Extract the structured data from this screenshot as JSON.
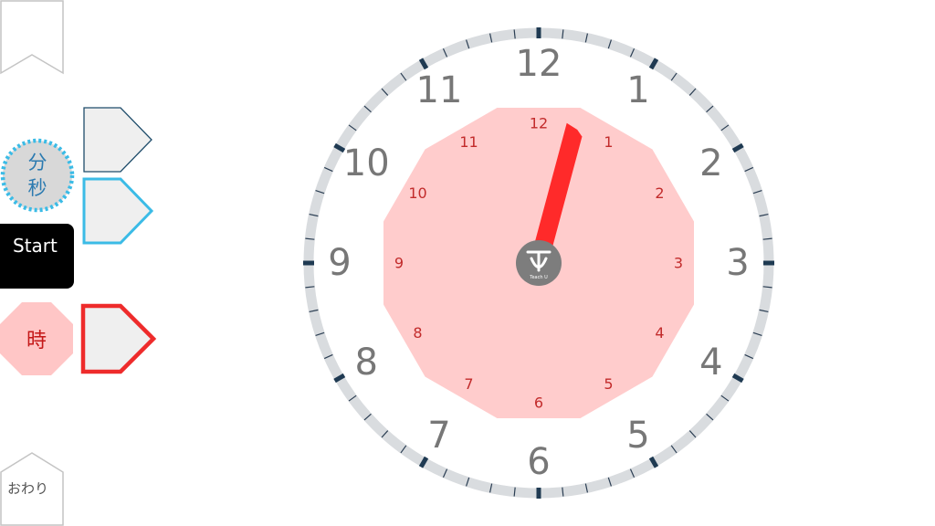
{
  "toolbar": {
    "minsec_label": "分秒",
    "start_label": "Start",
    "hour_label": "時",
    "end_label": "おわり"
  },
  "clock": {
    "outer_numbers": [
      "12",
      "1",
      "2",
      "3",
      "4",
      "5",
      "6",
      "7",
      "8",
      "9",
      "10",
      "11"
    ],
    "inner_numbers": [
      "12",
      "1",
      "2",
      "3",
      "4",
      "5",
      "6",
      "7",
      "8",
      "9",
      "10",
      "11"
    ],
    "hour_hand_position": 0.5,
    "center_logo": "Teach U",
    "colors": {
      "ring": "#d9dcdf",
      "major_tick": "#1f3a52",
      "numbers": "#777777",
      "inner_face": "#ffcccc",
      "inner_numbers": "#c22b2b",
      "hour_hand": "#ff2a2a",
      "hub": "#7d7d7d",
      "minsec_accent": "#3bbbe6",
      "hour_accent": "#ee2b2b"
    }
  }
}
